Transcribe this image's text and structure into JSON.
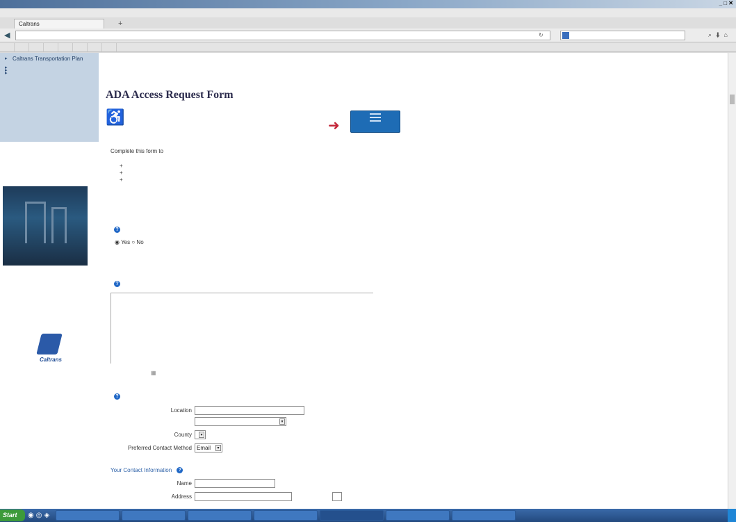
{
  "browser": {
    "window_title": "",
    "menu": [
      "",
      "",
      "",
      "",
      "",
      "",
      ""
    ],
    "tab_title": "Caltrans",
    "new_tab": "+",
    "url": "",
    "bookmarks": [
      "",
      "",
      "",
      "",
      "",
      "",
      "",
      ""
    ]
  },
  "sidebar": {
    "items": [
      {
        "label": "Caltrans Transportation Plan"
      },
      {
        "label": ""
      },
      {
        "label": ""
      },
      {
        "label": ""
      }
    ],
    "promo_text": "",
    "note": "",
    "link": "",
    "logo_text": "Caltrans"
  },
  "form": {
    "title": "ADA Access Request Form",
    "intro": "Complete this form to",
    "bullets": [
      "",
      "",
      ""
    ],
    "paragraph": "",
    "disability_question": "",
    "radio_yes": "Yes",
    "radio_no": "No",
    "description_question": "",
    "date_label": "",
    "date_value": "",
    "location_question": "",
    "location_label": "Location",
    "city_label": "",
    "county_label": "County",
    "contact_method_label": "Preferred Contact Method",
    "contact_method_value": "Email",
    "contact_info_question": "Your Contact Information",
    "name_label": "Name",
    "address_label": "Address",
    "apt_label": ""
  },
  "taskbar": {
    "start": "Start",
    "tasks": [
      "",
      "",
      "",
      "",
      "",
      "",
      ""
    ]
  }
}
